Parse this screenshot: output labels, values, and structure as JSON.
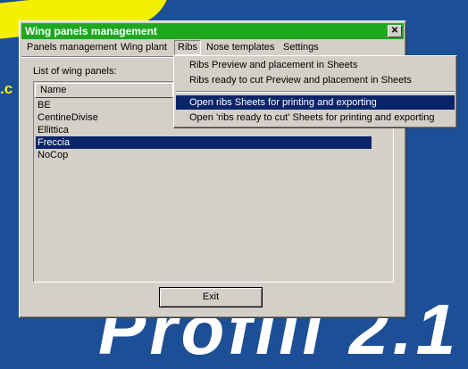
{
  "background": {
    "fragment_text": ".c",
    "big_text": "Profili 2.1"
  },
  "window": {
    "title": "Wing panels management",
    "close_glyph": "✕"
  },
  "menubar": {
    "items": [
      "Panels management",
      "Wing plant",
      "Ribs",
      "Nose templates",
      "Settings"
    ]
  },
  "list": {
    "label": "List of wing panels:",
    "column_header": "Name",
    "rows": [
      "BE",
      "CentineDivise",
      "Ellittica",
      "Freccia",
      "NoCop"
    ],
    "selected_index": 3
  },
  "buttons": {
    "exit": "Exit"
  },
  "ribs_menu": {
    "items": [
      "Ribs Preview and  placement in Sheets",
      "Ribs ready to cut Preview and  placement in Sheets",
      "Open ribs Sheets for printing and exporting",
      "Open 'ribs ready to cut' Sheets for printing and exporting"
    ],
    "highlighted_index": 2
  }
}
